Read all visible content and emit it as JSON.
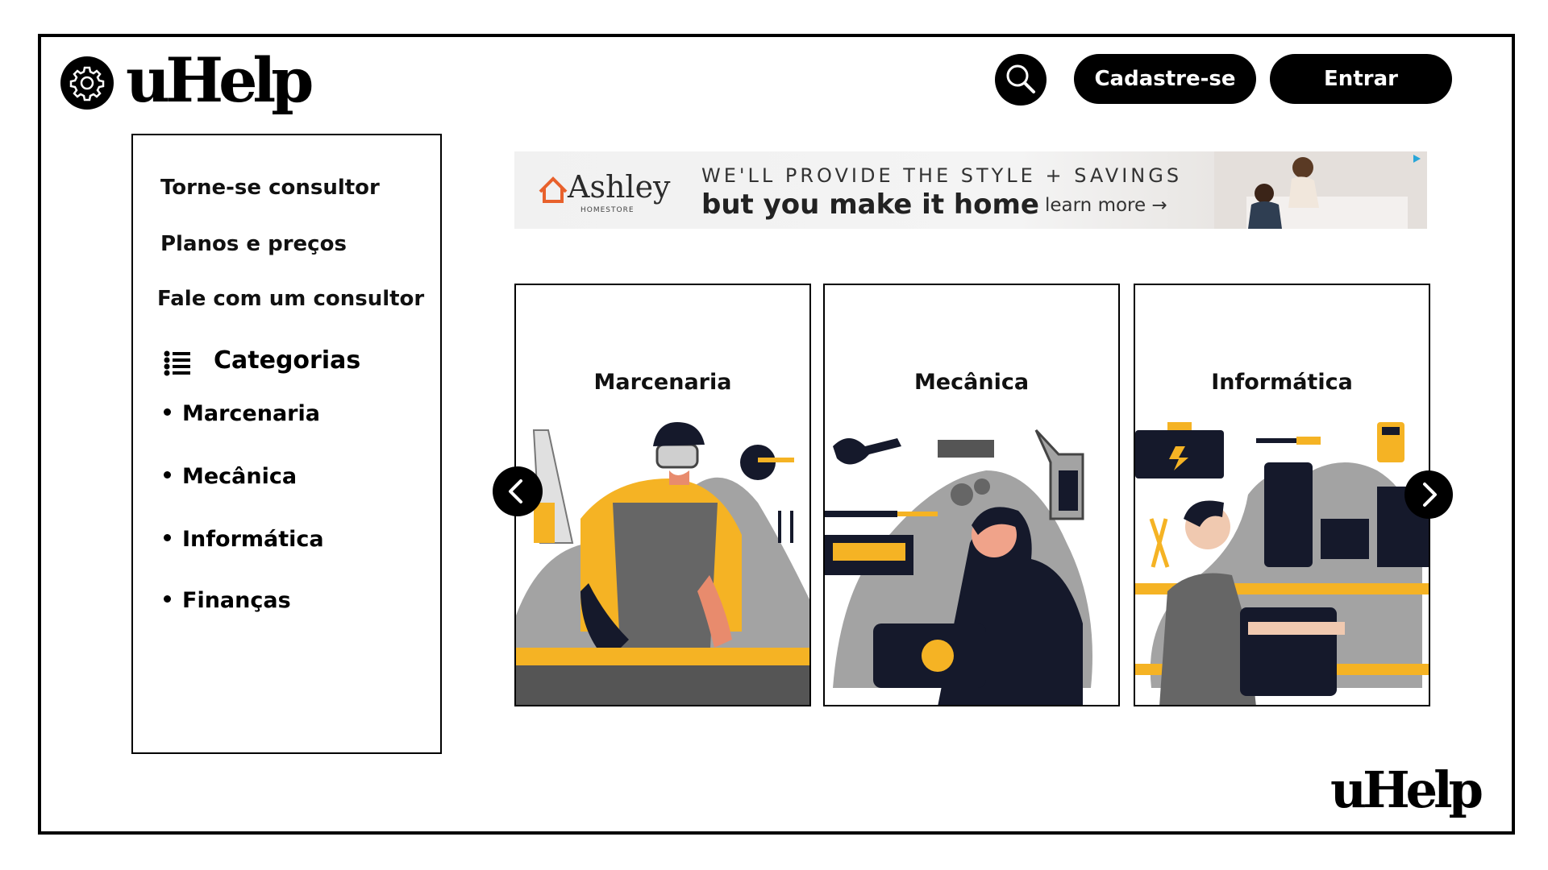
{
  "header": {
    "logo": "uHelp",
    "signup_label": "Cadastre-se",
    "login_label": "Entrar",
    "icons": {
      "settings": "gear-icon",
      "search": "magnifier-icon"
    }
  },
  "sidebar": {
    "links": [
      {
        "label": "Torne-se consultor"
      },
      {
        "label": "Planos e preços"
      },
      {
        "label": "Fale com um consultor"
      }
    ],
    "categories_title": "Categorias",
    "categories": [
      {
        "label": "Marcenaria"
      },
      {
        "label": "Mecânica"
      },
      {
        "label": "Informática"
      },
      {
        "label": "Finanças"
      }
    ]
  },
  "ad": {
    "brand": "Ashley",
    "brand_sub": "HOMESTORE",
    "line1": "WE'LL PROVIDE THE STYLE + SAVINGS",
    "line2": "but you make it home",
    "cta": "learn more →"
  },
  "carousel": {
    "cards": [
      {
        "title": "Marcenaria"
      },
      {
        "title": "Mecânica"
      },
      {
        "title": "Informática"
      }
    ]
  },
  "footer": {
    "logo": "uHelp"
  },
  "colors": {
    "accent": "#F5B324",
    "dark": "#15192B",
    "gray": "#A3A3A3",
    "black": "#000000"
  }
}
